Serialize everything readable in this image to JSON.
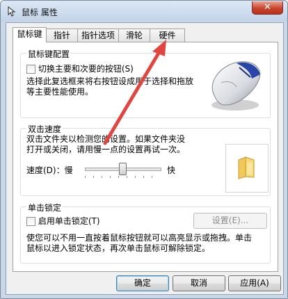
{
  "window": {
    "title": "鼠标 属性",
    "close_label": "✕"
  },
  "tabs": [
    {
      "label": "鼠标键",
      "active": true
    },
    {
      "label": "指针"
    },
    {
      "label": "指针选项"
    },
    {
      "label": "滑轮"
    },
    {
      "label": "硬件"
    }
  ],
  "button_config": {
    "title": "鼠标键配置",
    "switch_label": "切换主要和次要的按钮(S)",
    "switch_checked": false,
    "description_line1": "选择此复选框来将右按钮设成用于选择和拖放",
    "description_line2": "等主要性能使用。"
  },
  "double_click": {
    "title": "双击速度",
    "description_line1": "双击文件夹以检测您的设置。如果文件夹没",
    "description_line2": "打开或关闭，请用慢一点的设置再试一次。",
    "speed_label": "速度(D)：",
    "slow_label": "慢",
    "fast_label": "快",
    "speed_value": 0.5
  },
  "click_lock": {
    "title": "单击锁定",
    "enable_label": "启用单击锁定(T)",
    "enable_checked": false,
    "settings_label": "设置(E)...",
    "description_line1": "使您可以不用一直按着鼠标按钮就可以高亮显示或拖拽。单击",
    "description_line2": "鼠标以进入锁定状态，再次单击鼠标可解除锁定。"
  },
  "footer": {
    "ok_label": "确定",
    "cancel_label": "取消",
    "apply_label": "应用(A)"
  },
  "colors": {
    "annotation_arrow": "#e0463f"
  }
}
